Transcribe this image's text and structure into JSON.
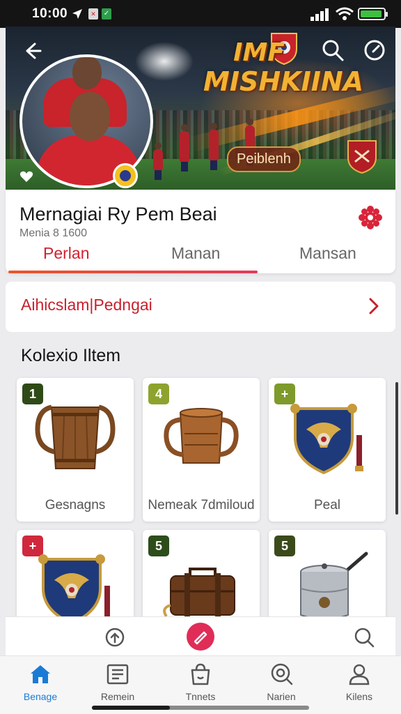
{
  "status": {
    "time": "10:00",
    "icons": [
      "location-arrow-icon",
      "app-notification-icon",
      "app-notification-icon",
      "signal-icon",
      "wifi-icon",
      "battery-charging-icon"
    ]
  },
  "hero": {
    "title_line1": "IMF",
    "title_line2": "MISHKIINA",
    "badge": "Peiblenh",
    "back_icon": "arrow-left-icon",
    "search_icon": "search-icon",
    "compass_icon": "compass-icon"
  },
  "profile": {
    "name": "Mernagiai Ry Pem Beai",
    "sub": "Menia 8 1600",
    "action_icon": "gear-icon",
    "tabs": [
      {
        "label": "Perlan",
        "active": true
      },
      {
        "label": "Manan",
        "active": false
      },
      {
        "label": "Mansan",
        "active": false
      }
    ]
  },
  "link_row": {
    "label": "Aihicslam|Pedngai"
  },
  "collection": {
    "title": "Kolexio Iltem",
    "items": [
      {
        "badge": "1",
        "badge_color": "#2f4a17",
        "label": "Gesnagns",
        "icon": "wooden-mug-icon"
      },
      {
        "badge": "4",
        "badge_color": "#8da32e",
        "label": "Nemeak 7dmiloud",
        "icon": "copper-mug-icon"
      },
      {
        "badge": "+",
        "badge_color": "#7e9a2b",
        "label": "Peal",
        "icon": "club-shield-icon"
      },
      {
        "badge": "+",
        "badge_color": "#d0283d",
        "label": "",
        "icon": "club-shield-icon"
      },
      {
        "badge": "5",
        "badge_color": "#2d4d1b",
        "label": "",
        "icon": "briefcase-icon"
      },
      {
        "badge": "5",
        "badge_color": "#3b4a1b",
        "label": "",
        "icon": "cooking-pot-icon"
      }
    ]
  },
  "toolbar": {
    "left_icon": "refresh-icon",
    "center_icon": "edit-icon",
    "right_icon": "search-icon"
  },
  "nav": [
    {
      "label": "Benage",
      "icon": "home-icon",
      "active": true
    },
    {
      "label": "Remein",
      "icon": "list-icon",
      "active": false
    },
    {
      "label": "Tnnets",
      "icon": "bag-icon",
      "active": false
    },
    {
      "label": "Narien",
      "icon": "explore-icon",
      "active": false
    },
    {
      "label": "Kilens",
      "icon": "profile-icon",
      "active": false
    }
  ],
  "colors": {
    "accent": "#d3202f",
    "nav_active": "#1a7bd6",
    "fab": "#e02d58"
  }
}
